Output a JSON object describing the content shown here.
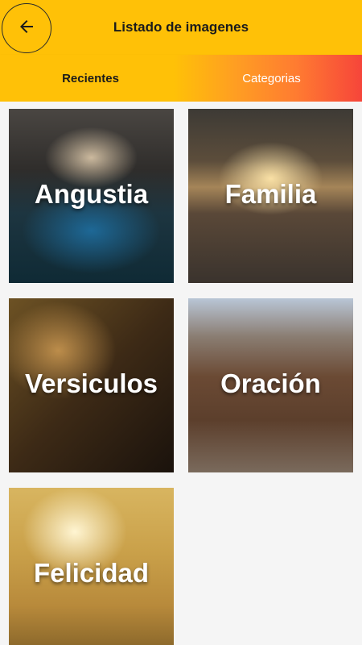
{
  "header": {
    "title": "Listado de imagenes",
    "back_icon": "arrow-left-icon"
  },
  "tabs": [
    {
      "label": "Recientes",
      "active": true
    },
    {
      "label": "Categorias",
      "active": false
    }
  ],
  "categories": [
    {
      "label": "Angustia"
    },
    {
      "label": "Familia"
    },
    {
      "label": "Versiculos"
    },
    {
      "label": "Oración"
    },
    {
      "label": "Felicidad"
    }
  ],
  "colors": {
    "appbar": "#ffc107",
    "tab_gradient_end": "#f6453a"
  }
}
